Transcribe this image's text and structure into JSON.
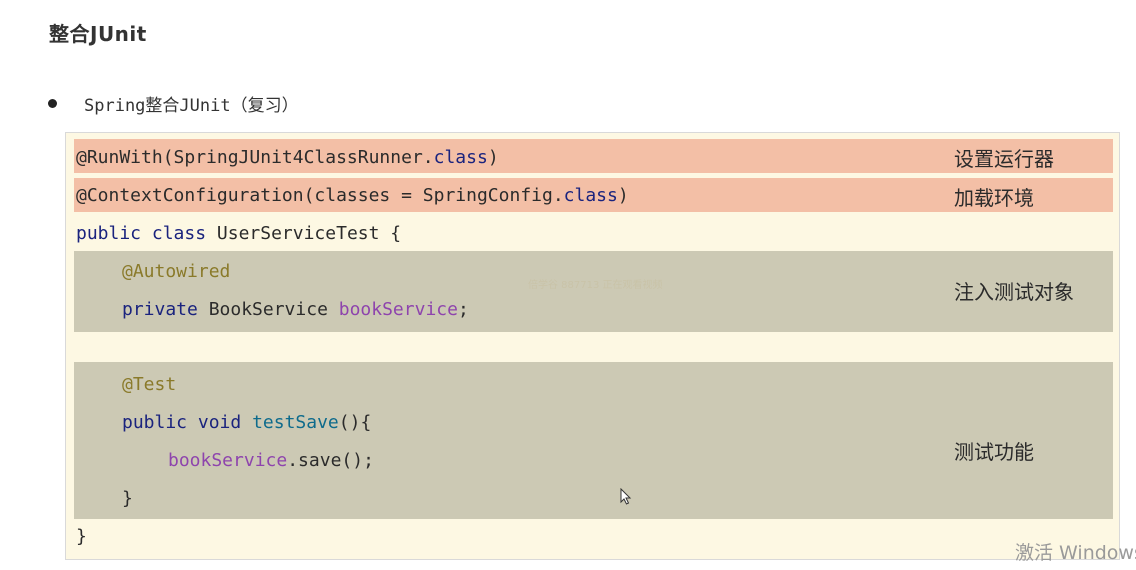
{
  "heading": "整合JUnit",
  "bullet": "Spring整合JUnit（复习）",
  "code": {
    "line1_annotation": "@RunWith(SpringJUnit4ClassRunner.",
    "line1_keyword": "class",
    "line1_end": ")",
    "line2_annotation": "@ContextConfiguration(classes = SpringConfig.",
    "line2_keyword": "class",
    "line2_end": ")",
    "line3_public": "public",
    "line3_class": "class",
    "line3_rest": " UserServiceTest {",
    "line4": "@Autowired",
    "line5_private": "private",
    "line5_type": " BookService ",
    "line5_field": "bookService",
    "line5_end": ";",
    "line6": "@Test",
    "line7_public": "public",
    "line7_void": "void",
    "line7_method": "testSave",
    "line7_end": "(){",
    "line8_field": "bookService",
    "line8_end": ".save();",
    "line9": "}",
    "line10": "}"
  },
  "notes": {
    "runner": "设置运行器",
    "env": "加载环境",
    "inject": "注入测试对象",
    "test": "测试功能"
  },
  "watermark": "倍学谷 887713 正在观看视频",
  "activation": "激活 Windows",
  "colors": {
    "panel_bg": "#fdf8e3",
    "pink_band": "#f3bfa6",
    "gray_band": "#ccc9b4"
  }
}
